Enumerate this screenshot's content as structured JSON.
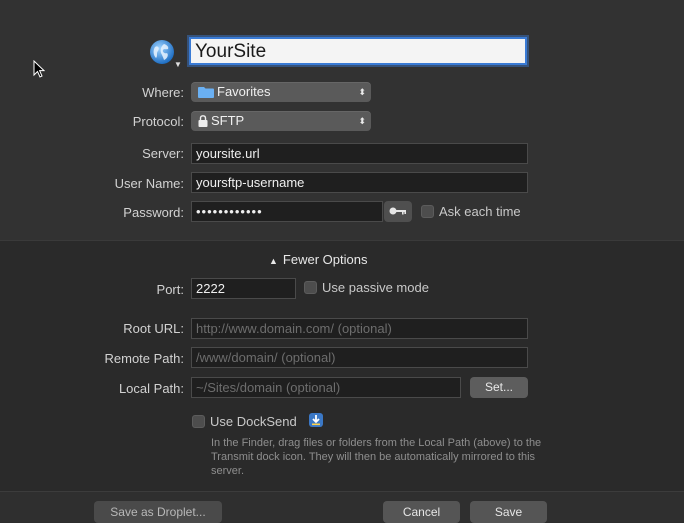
{
  "site": {
    "name": "YourSite"
  },
  "form": {
    "where": {
      "label": "Where:",
      "value": "Favorites"
    },
    "protocol": {
      "label": "Protocol:",
      "value": "SFTP"
    },
    "server": {
      "label": "Server:",
      "value": "yoursite.url"
    },
    "username": {
      "label": "User Name:",
      "value": "yoursftp-username"
    },
    "password": {
      "label": "Password:",
      "value": "••••••••••••"
    },
    "ask_each_time": {
      "label": "Ask each time",
      "checked": false
    }
  },
  "options": {
    "toggle_label": "Fewer Options",
    "port": {
      "label": "Port:",
      "value": "2222"
    },
    "passive": {
      "label": "Use passive mode",
      "checked": false
    },
    "root_url": {
      "label": "Root URL:",
      "placeholder": "http://www.domain.com/ (optional)"
    },
    "remote_path": {
      "label": "Remote Path:",
      "placeholder": "/www/domain/ (optional)"
    },
    "local_path": {
      "label": "Local Path:",
      "placeholder": "~/Sites/domain (optional)",
      "set_button": "Set..."
    },
    "docksend": {
      "label": "Use DockSend",
      "checked": false,
      "hint": "In the Finder, drag files or folders from the Local Path (above) to the Transmit dock icon. They will then be automatically mirrored to this server."
    }
  },
  "footer": {
    "save_as_droplet": "Save as Droplet...",
    "cancel": "Cancel",
    "save": "Save"
  },
  "icons": {
    "site": "globe-icon",
    "where": "folder-icon",
    "protocol": "lock-icon",
    "password": "key-icon",
    "docksend": "docksend-icon"
  },
  "colors": {
    "focus_ring": "#3a7bd5",
    "folder": "#6ab0f3"
  }
}
